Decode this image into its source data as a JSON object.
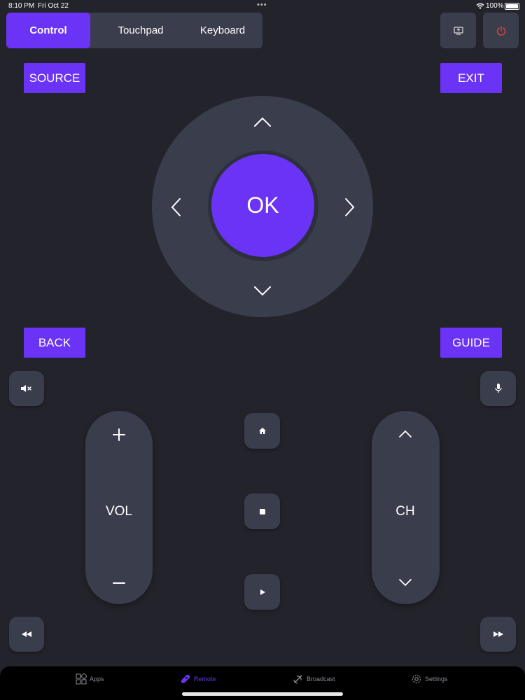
{
  "status_bar": {
    "time": "8:10 PM",
    "date": "Fri Oct 22",
    "battery": "100%"
  },
  "segment": {
    "tabs": [
      "Control",
      "Touchpad",
      "Keyboard"
    ],
    "active": "Control"
  },
  "buttons": {
    "source": "SOURCE",
    "exit": "EXIT",
    "ok": "OK",
    "back": "BACK",
    "guide": "GUIDE",
    "vol": "VOL",
    "ch": "CH"
  },
  "tab_bar": {
    "items": [
      {
        "label": "Apps",
        "icon": "apps-icon"
      },
      {
        "label": "Remote",
        "icon": "remote-icon",
        "active": true
      },
      {
        "label": "Broadcast",
        "icon": "broadcast-icon"
      },
      {
        "label": "Settings",
        "icon": "settings-icon"
      }
    ]
  },
  "colors": {
    "accent": "#6a33f5",
    "background": "#23232b",
    "surface": "#3a3d4c",
    "power": "#e0403a"
  }
}
